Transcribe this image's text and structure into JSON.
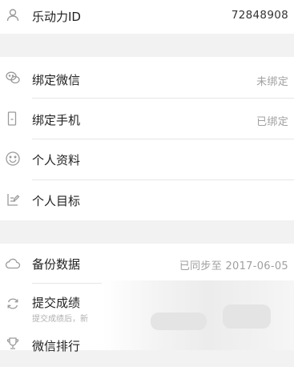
{
  "account": {
    "id_label": "乐动力ID",
    "id_value": "72848908"
  },
  "settings": [
    {
      "label": "绑定微信",
      "value": "未绑定",
      "icon": "wechat-icon"
    },
    {
      "label": "绑定手机",
      "value": "已绑定",
      "icon": "phone-icon"
    },
    {
      "label": "个人资料",
      "value": "",
      "icon": "smile-icon"
    },
    {
      "label": "个人目标",
      "value": "",
      "icon": "edit-icon"
    }
  ],
  "data_section": {
    "backup": {
      "label": "备份数据",
      "value": "已同步至  2017-06-05",
      "icon": "cloud-icon"
    },
    "submit": {
      "label": "提交成绩",
      "sub": "提交成绩后，新",
      "icon": "refresh-icon"
    },
    "ranking": {
      "label": "微信排行",
      "icon": "trophy-icon"
    }
  }
}
